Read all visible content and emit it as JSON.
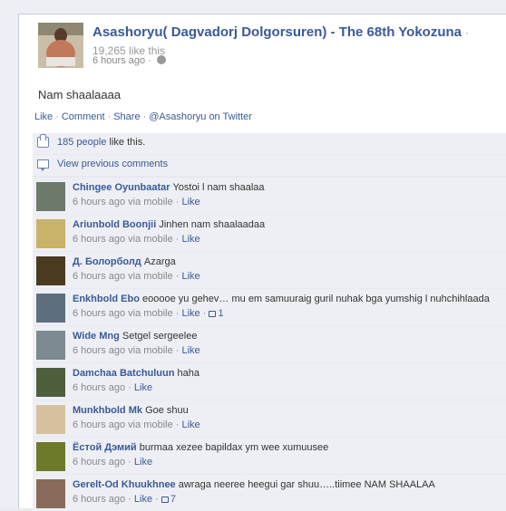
{
  "post": {
    "author": "Asashoryu( Dagvadorj Dolgorsuren) - The 68th Yokozuna",
    "page_likes": "19,265 like this",
    "time": "6 hours ago",
    "message": "Nam shaalaaaa"
  },
  "actions": {
    "like": "Like",
    "comment": "Comment",
    "share": "Share",
    "twitter": "@Asashoryu on Twitter"
  },
  "likes_row": {
    "count_link": "185 people",
    "suffix": "like this."
  },
  "view_previous": "View previous comments",
  "comments": [
    {
      "author": "Chingee Oyunbaatar",
      "text": "Yostoi l nam shaalaa",
      "time": "6 hours ago",
      "via": "via mobile",
      "like": "Like",
      "likes": "",
      "avatar_color": "#6b7a6a"
    },
    {
      "author": "Ariunbold Boonjii",
      "text": "Jinhen nam shaalaadaa",
      "time": "6 hours ago",
      "via": "via mobile",
      "like": "Like",
      "likes": "",
      "avatar_color": "#c9b26a"
    },
    {
      "author": "Д. Болорболд",
      "text": "Azarga",
      "time": "6 hours ago",
      "via": "via mobile",
      "like": "Like",
      "likes": "",
      "avatar_color": "#4a3a20"
    },
    {
      "author": "Enkhbold Ebo",
      "text": "eooooe yu gehev… mu em samuuraig guril nuhak bga yumshig l nuhchihlaada",
      "time": "6 hours ago",
      "via": "via mobile",
      "like": "Like",
      "likes": "1",
      "avatar_color": "#5e6f80"
    },
    {
      "author": "Wide Mng",
      "text": "Setgel sergeelee",
      "time": "6 hours ago",
      "via": "via mobile",
      "like": "Like",
      "likes": "",
      "avatar_color": "#7d8a8f"
    },
    {
      "author": "Damchaa Batchuluun",
      "text": "haha",
      "time": "6 hours ago",
      "via": "",
      "like": "Like",
      "likes": "",
      "avatar_color": "#4f5e3d"
    },
    {
      "author": "Munkhbold Mk",
      "text": "Goe shuu",
      "time": "6 hours ago",
      "via": "via mobile",
      "like": "Like",
      "likes": "",
      "avatar_color": "#d8c1a0"
    },
    {
      "author": "Ёстой Дэмий",
      "text": "burmaa xezee bapildax ym wee xumuusee",
      "time": "6 hours ago",
      "via": "",
      "like": "Like",
      "likes": "",
      "avatar_color": "#6c7a2a"
    },
    {
      "author": "Gerelt-Od Khuukhnee",
      "text": "awraga neeree heegui gar shuu…..tiimee NAM SHAALAA",
      "time": "6 hours ago",
      "via": "",
      "like": "Like",
      "likes": "7",
      "avatar_color": "#8a6a5a"
    }
  ],
  "colors": {
    "link": "#3b5998",
    "ufi_background": "#edeff4",
    "meta_text": "#888888"
  },
  "icons": [
    "globe-icon",
    "thumb-icon",
    "bubble-icon",
    "small-thumb-icon"
  ]
}
